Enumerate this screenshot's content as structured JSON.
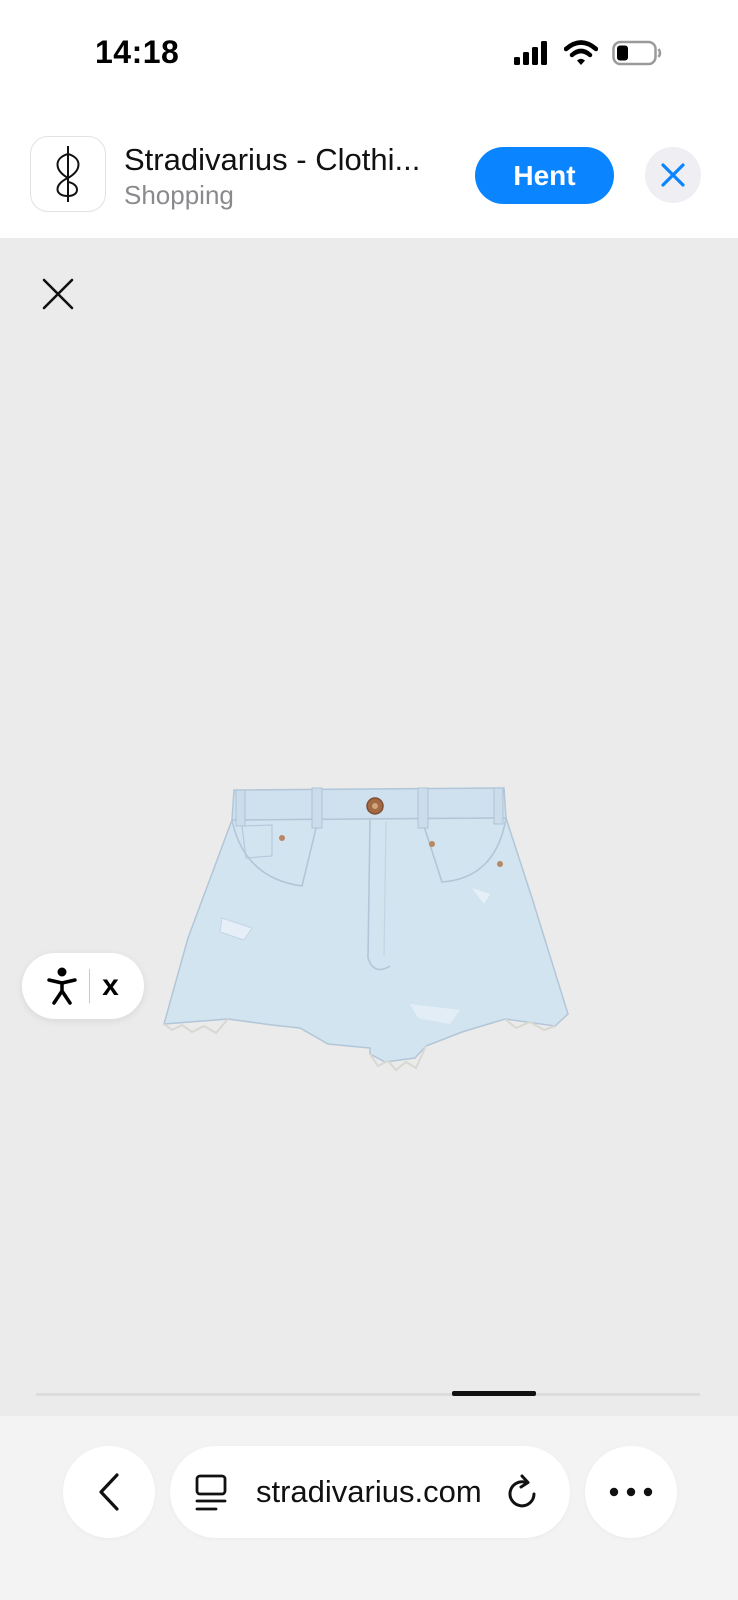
{
  "status_bar": {
    "time": "14:18",
    "icons": [
      "cellular-signal-icon",
      "wifi-icon",
      "battery-icon"
    ]
  },
  "app_banner": {
    "app_name": "Stradivarius - Clothi...",
    "category": "Shopping",
    "get_label": "Hent",
    "icon": "stradivarius-logo",
    "accent_color": "#0a84ff"
  },
  "product_view": {
    "close_icon": "close-icon",
    "image": "light-blue-denim-shorts",
    "background_color": "#ebebeb",
    "carousel_progress": 0.13
  },
  "accessibility_widget": {
    "icon": "accessibility-person-icon",
    "close_label": "x"
  },
  "browser_toolbar": {
    "url": "stradivarius.com",
    "back_icon": "chevron-left-icon",
    "reader_icon": "page-menu-icon",
    "reload_icon": "reload-icon",
    "more_icon": "more-dots-icon"
  }
}
